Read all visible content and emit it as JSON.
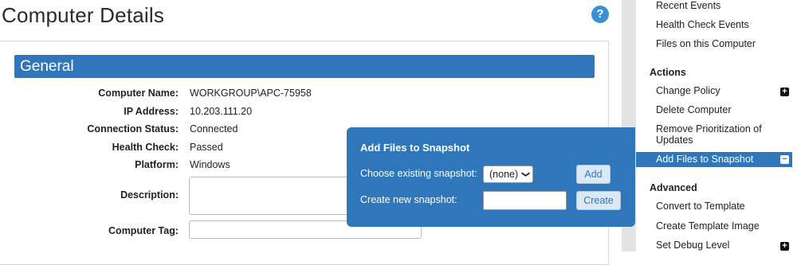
{
  "page": {
    "title": "Computer Details"
  },
  "general": {
    "header": "General",
    "fields": [
      {
        "label": "Computer Name:",
        "value": "WORKGROUP\\APC-75958"
      },
      {
        "label": "IP Address:",
        "value": "10.203.111.20"
      },
      {
        "label": "Connection Status:",
        "value": "Connected"
      },
      {
        "label": "Health Check:",
        "value": "Passed"
      },
      {
        "label": "Platform:",
        "value": "Windows"
      }
    ],
    "description_label": "Description:",
    "description_value": "",
    "tag_label": "Computer Tag:",
    "tag_value": ""
  },
  "sidebar": {
    "top_items": [
      "Recent Events",
      "Health Check Events",
      "Files on this Computer"
    ],
    "actions_heading": "Actions",
    "actions": [
      "Change Policy",
      "Delete Computer",
      "Remove Prioritization of Updates",
      "Add Files to Snapshot"
    ],
    "advanced_heading": "Advanced",
    "advanced": [
      "Convert to Template",
      "Create Template Image",
      "Set Debug Level"
    ]
  },
  "popup": {
    "title": "Add Files to Snapshot",
    "existing_label": "Choose existing snapshot:",
    "existing_selected": "(none)",
    "add_button": "Add",
    "new_label": "Create new snapshot:",
    "new_value": "",
    "create_button": "Create"
  },
  "colors": {
    "accent": "#2f77ba",
    "help": "#3a8fd6"
  },
  "icons": {
    "help": "question-mark",
    "expand": "plus",
    "collapse": "minus",
    "dropdown": "chevron-down"
  }
}
